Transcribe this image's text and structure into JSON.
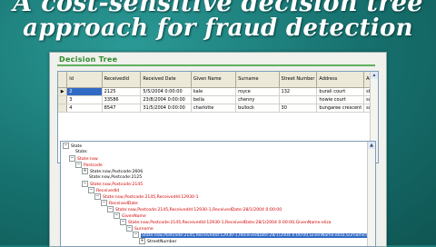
{
  "headline": {
    "line1": "A cost-sensitive decision tree",
    "line2": "approach for fraud detection"
  },
  "panel": {
    "title": "Decision Tree"
  },
  "grid": {
    "columns": [
      "Id",
      "ReceivedId",
      "Received Date",
      "Given Name",
      "Surname",
      "Street Number",
      "Address",
      "Ad"
    ],
    "rows": [
      [
        "2",
        "2125",
        "5/5/2004 0:00:00",
        "kale",
        "royce",
        "132",
        "burali court",
        "st h"
      ],
      [
        "3",
        "33586",
        "23/8/2004 0:00:00",
        "bella",
        "chenny",
        "",
        "howie court",
        "swa"
      ],
      [
        "4",
        "8547",
        "31/5/2004 0:00:00",
        "charlotte",
        "bullock",
        "30",
        "bungaree crescent",
        "swi"
      ]
    ],
    "selected_row": 0
  },
  "tree": {
    "nodes": [
      {
        "label": "State",
        "color": "black",
        "expander": "-"
      },
      {
        "label": "State:",
        "color": "black",
        "expander": ""
      },
      {
        "label": "State:nsw",
        "color": "red",
        "expander": "-"
      },
      {
        "label": "Postcode",
        "color": "red",
        "expander": "-"
      },
      {
        "label": "State:nsw,Postcode:2606",
        "color": "black",
        "expander": "+"
      },
      {
        "label": "State:nsw,Postcode:2125",
        "color": "black",
        "expander": ""
      },
      {
        "label": "State:nsw,Postcode:2145",
        "color": "red",
        "expander": "-"
      },
      {
        "label": "ReceivedId",
        "color": "red",
        "expander": "-"
      },
      {
        "label": "State:nsw,Postcode:2145,ReceivedId:12930-1",
        "color": "red",
        "expander": "-"
      },
      {
        "label": "ReceivedDate",
        "color": "red",
        "expander": "-"
      },
      {
        "label": "State:nsw,Postcode:2145,ReceivedId:12930-1,ReceivedDate:28/1/2004 0:00:00",
        "color": "red",
        "expander": "-"
      },
      {
        "label": "GivenName",
        "color": "red",
        "expander": "-"
      },
      {
        "label": "State:nsw,Postcode:2145,ReceivedId:12930-1,ReceivedDate:28/1/2004 0:00:00,GivenName:eliza",
        "color": "red",
        "expander": "-"
      },
      {
        "label": "Surname",
        "color": "red",
        "expander": "-"
      },
      {
        "label": "State:nsw,Postcode:2145,ReceivedId:12930-1,ReceivedDate:28/1/2004 0:00:00,GivenName:eliza,Surname:be",
        "color": "highlight",
        "expander": "-"
      },
      {
        "label": "StreetNumber",
        "color": "black",
        "expander": "+"
      }
    ]
  }
}
